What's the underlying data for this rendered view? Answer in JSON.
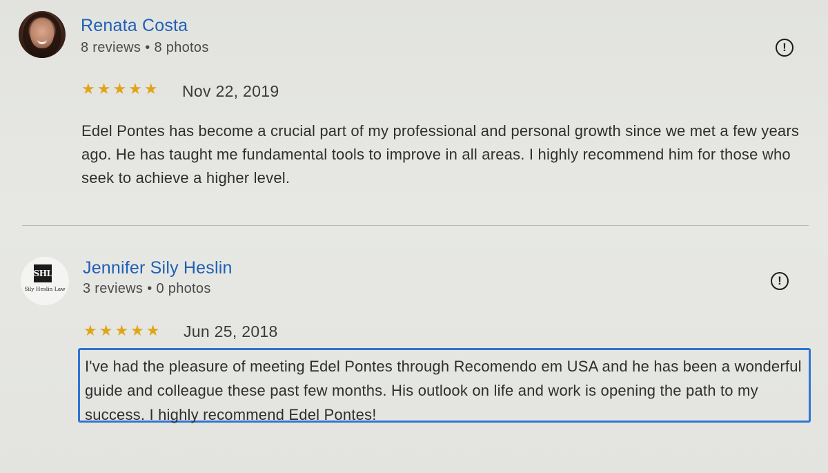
{
  "reviews": [
    {
      "author": "Renata Costa",
      "reviews_count": "8 reviews",
      "photos_count": "8 photos",
      "stars": "★★★★★",
      "rating": 5,
      "date": "Nov 22, 2019",
      "text": "Edel Pontes has become a crucial part of my professional and personal growth since we met a few years ago. He has taught me fundamental tools to improve in all areas. I highly recommend him for those who seek to achieve a higher level."
    },
    {
      "author": "Jennifer Sily Heslin",
      "reviews_count": "3 reviews",
      "photos_count": "0 photos",
      "logo_text": "SHL",
      "logo_caption": "Sily Heslin Law",
      "stars": "★★★★★",
      "rating": 5,
      "date": "Jun 25, 2018",
      "text": "I've had the pleasure of meeting Edel Pontes through Recomendo em USA and he has been a wonderful guide and colleague these past few months. His outlook on life and work is opening the path to my success. I highly recommend Edel Pontes!"
    }
  ],
  "meta_separator": "•",
  "flag_icon_glyph": "!",
  "colors": {
    "name_link": "#1f5fb5",
    "star": "#e0a516",
    "highlight_border": "#2f74d0"
  }
}
